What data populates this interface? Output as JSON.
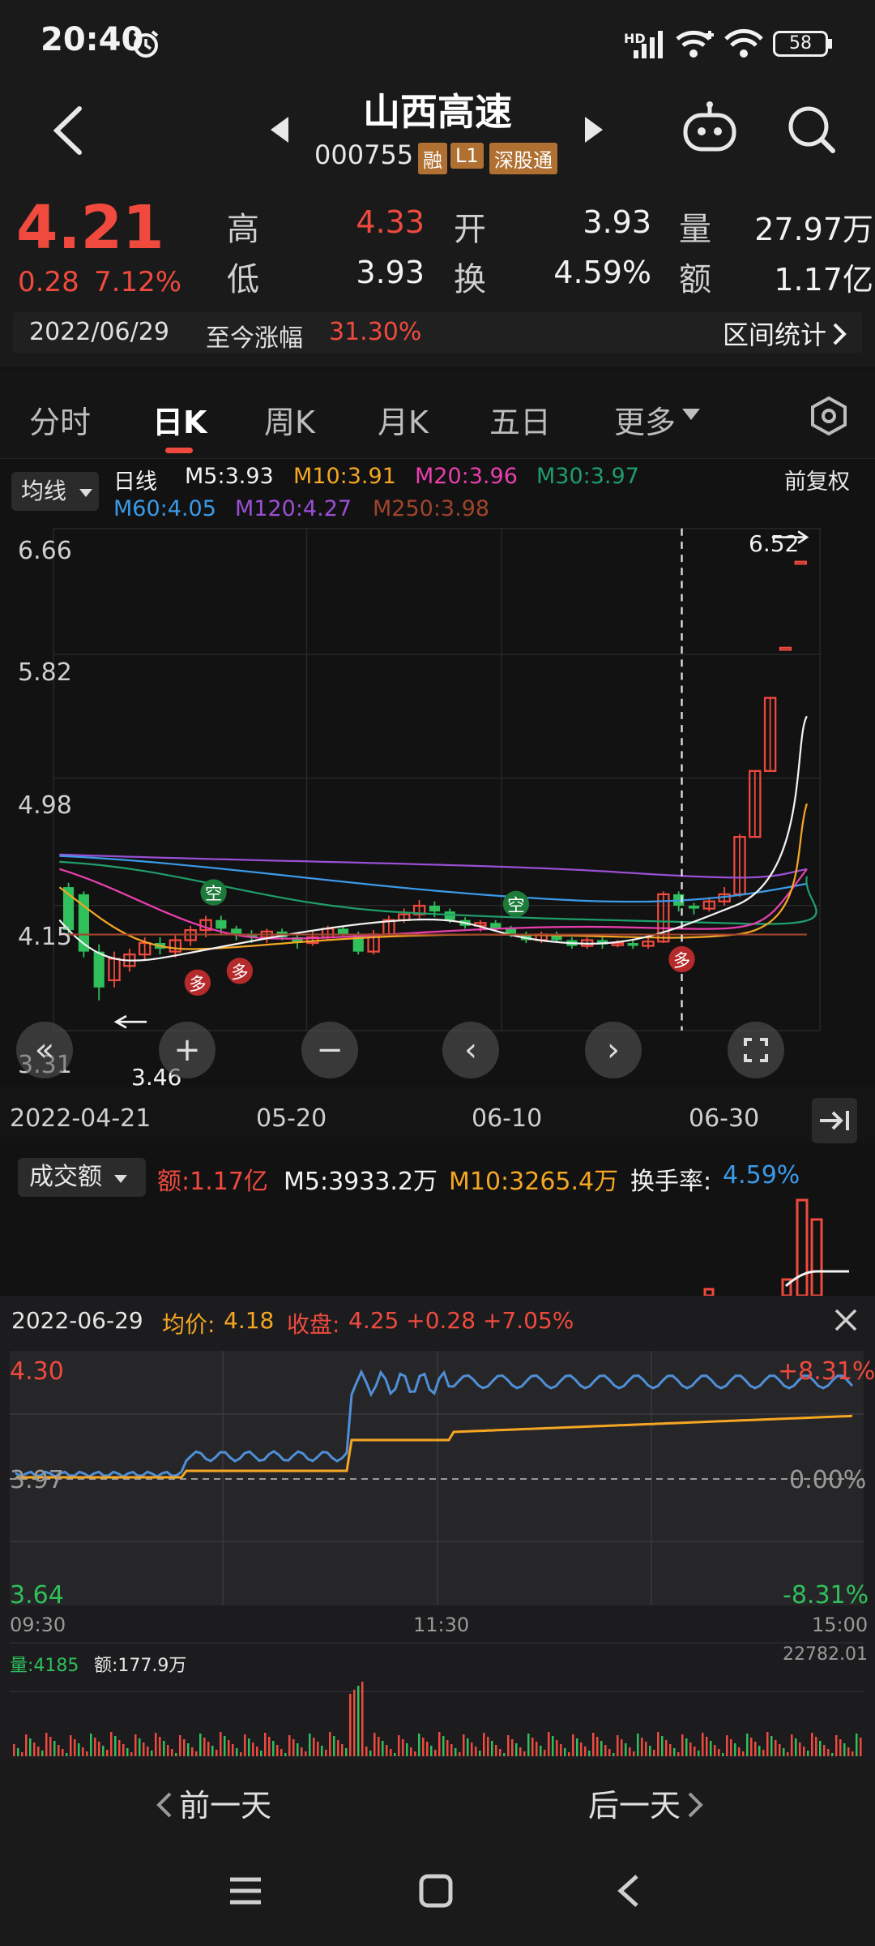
{
  "status_bar": {
    "time": "20:40",
    "network": "HD",
    "battery": "58"
  },
  "header": {
    "name": "山西高速",
    "code": "000755",
    "tags": [
      "融",
      "L1",
      "深股通"
    ]
  },
  "quote": {
    "price": "4.21",
    "change": "0.28",
    "change_pct": "7.12%",
    "high_label": "高",
    "high": "4.33",
    "open_label": "开",
    "open": "3.93",
    "volume_label": "量",
    "volume": "27.97万",
    "low_label": "低",
    "low": "3.93",
    "turnover_label": "换",
    "turnover": "4.59%",
    "amount_label": "额",
    "amount": "1.17亿",
    "date": "2022/06/29",
    "gain_label": "至今涨幅",
    "gain": "31.30%",
    "range_stats": "区间统计"
  },
  "tabs": [
    "分时",
    "日K",
    "周K",
    "月K",
    "五日",
    "更多"
  ],
  "ma_legend": {
    "dropdown": "均线",
    "period": "日线",
    "adjust": "前复权",
    "items": [
      {
        "label": "M5:3.93",
        "color": "#f2f2f2"
      },
      {
        "label": "M10:3.91",
        "color": "#f5a623"
      },
      {
        "label": "M20:3.96",
        "color": "#e83fae"
      },
      {
        "label": "M30:3.97",
        "color": "#1f9e6b"
      },
      {
        "label": "M60:4.05",
        "color": "#3b9ae8"
      },
      {
        "label": "M120:4.27",
        "color": "#9a4fd4"
      },
      {
        "label": "M250:3.98",
        "color": "#a0442c"
      }
    ]
  },
  "kline": {
    "y_labels": [
      "6.66",
      "5.82",
      "4.98",
      "4.15",
      "3.31"
    ],
    "max_label": "6.52",
    "min_label": "3.46",
    "x_labels": [
      "2022-04-21",
      "05-20",
      "06-10",
      "06-30"
    ],
    "signals": {
      "kong": "空",
      "duo": "多"
    }
  },
  "volume": {
    "dropdown": "成交额",
    "amount": "额:1.17亿",
    "m5": "M5:3933.2万",
    "m10": "M10:3265.4万",
    "turnover_label": "换手率:",
    "turnover": "4.59%"
  },
  "intraday": {
    "date": "2022-06-29",
    "avg_label": "均价:",
    "avg": "4.18",
    "close_label": "收盘:",
    "close": "4.25 +0.28 +7.05%",
    "y_top": "4.30",
    "y_mid": "3.97",
    "y_bot": "3.64",
    "pct_top": "+8.31%",
    "pct_mid": "0.00%",
    "pct_bot": "-8.31%",
    "t_start": "09:30",
    "t_mid": "11:30",
    "t_end": "15:00",
    "vol_label": "量:4185",
    "amt_label": "额:177.9万",
    "vol_max": "22782.01"
  },
  "day_nav": {
    "prev": "前一天",
    "next": "后一天"
  }
}
